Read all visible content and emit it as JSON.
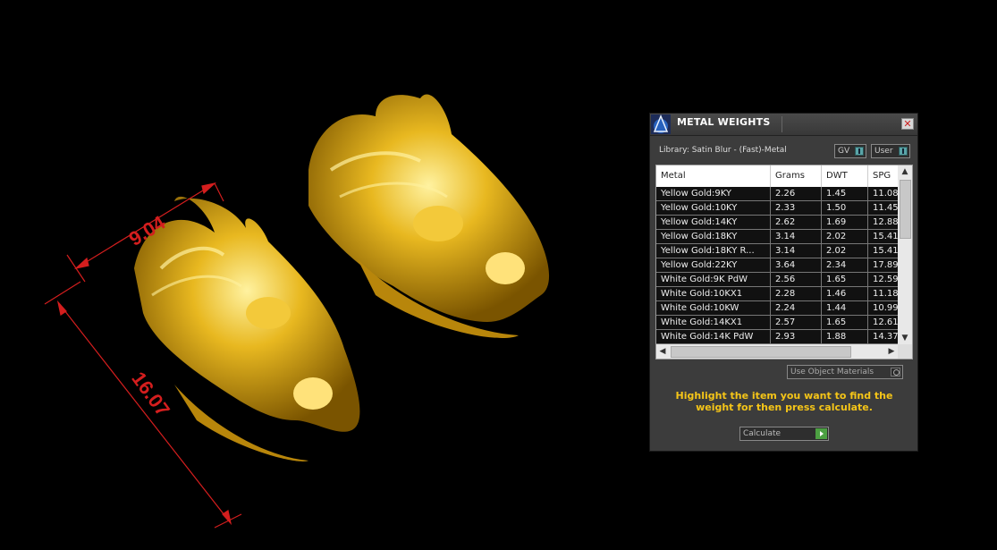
{
  "viewport": {
    "dimensions": {
      "width_label": "9.04",
      "length_label": "16.07"
    },
    "annotation_color": "#d41e1e",
    "model_color": "#d8a51a"
  },
  "panel": {
    "title": "METAL WEIGHTS",
    "library_label": "Library: Satin Blur - (Fast)-Metal",
    "gv_label": "GV",
    "user_label": "User",
    "columns": [
      "Metal",
      "Grams",
      "DWT",
      "SPG"
    ],
    "rows": [
      {
        "metal": "Yellow Gold:9KY",
        "grams": "2.26",
        "dwt": "1.45",
        "spg": "11.08"
      },
      {
        "metal": "Yellow Gold:10KY",
        "grams": "2.33",
        "dwt": "1.50",
        "spg": "11.45"
      },
      {
        "metal": "Yellow Gold:14KY",
        "grams": "2.62",
        "dwt": "1.69",
        "spg": "12.88"
      },
      {
        "metal": "Yellow Gold:18KY",
        "grams": "3.14",
        "dwt": "2.02",
        "spg": "15.41"
      },
      {
        "metal": "Yellow Gold:18KY R...",
        "grams": "3.14",
        "dwt": "2.02",
        "spg": "15.41"
      },
      {
        "metal": "Yellow Gold:22KY",
        "grams": "3.64",
        "dwt": "2.34",
        "spg": "17.89"
      },
      {
        "metal": "White Gold:9K PdW",
        "grams": "2.56",
        "dwt": "1.65",
        "spg": "12.59"
      },
      {
        "metal": "White Gold:10KX1",
        "grams": "2.28",
        "dwt": "1.46",
        "spg": "11.18"
      },
      {
        "metal": "White Gold:10KW",
        "grams": "2.24",
        "dwt": "1.44",
        "spg": "10.99"
      },
      {
        "metal": "White Gold:14KX1",
        "grams": "2.57",
        "dwt": "1.65",
        "spg": "12.61"
      },
      {
        "metal": "White Gold:14K PdW",
        "grams": "2.93",
        "dwt": "1.88",
        "spg": "14.37"
      }
    ],
    "use_object_materials_label": "Use Object Materials",
    "instructions": "Highlight the item you want to find the weight for then press calculate.",
    "calculate_label": "Calculate",
    "accent_color": "#f5c518"
  }
}
